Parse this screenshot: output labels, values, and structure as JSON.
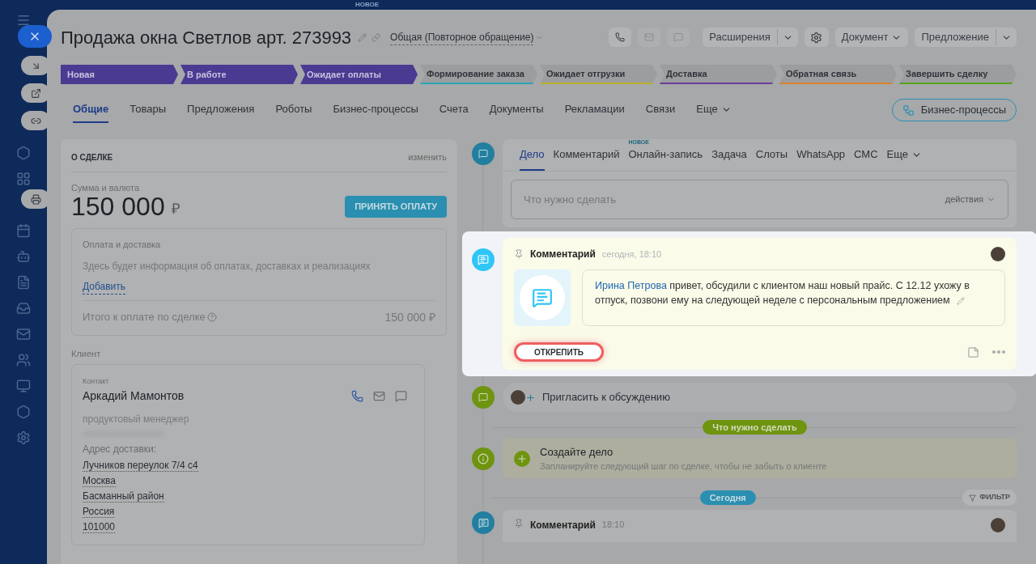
{
  "top_badge": "НОВОЕ",
  "title": "Продажа окна Светлов арт. 273993",
  "category": "Общая (Повторное обращение)",
  "header_buttons": [
    {
      "kind": "split",
      "label": "Расширения"
    },
    {
      "kind": "settings"
    },
    {
      "kind": "dropdown",
      "label": "Документ"
    },
    {
      "kind": "split",
      "label": "Предложение"
    }
  ],
  "stages": [
    {
      "label": "Новая",
      "passed": true,
      "color": "#4b3a92"
    },
    {
      "label": "В работе",
      "passed": true,
      "color": "#4b3a92"
    },
    {
      "label": "Ожидает оплаты",
      "passed": true,
      "color": "#4b3a92"
    },
    {
      "label": "Формирование заказа",
      "passed": false,
      "color": "#2aa5b5"
    },
    {
      "label": "Ожидает отгрузки",
      "passed": false,
      "color": "#b8b12a"
    },
    {
      "label": "Доставка",
      "passed": false,
      "color": "#6a3d9a"
    },
    {
      "label": "Обратная связь",
      "passed": false,
      "color": "#d9822b"
    },
    {
      "label": "Завершить сделку",
      "passed": false,
      "color": "#55a51c"
    }
  ],
  "tabs": [
    {
      "label": "Общие",
      "selected": true
    },
    {
      "label": "Товары",
      "selected": false
    },
    {
      "label": "Предложения",
      "selected": false
    },
    {
      "label": "Роботы",
      "selected": false
    },
    {
      "label": "Бизнес-процессы",
      "selected": false
    },
    {
      "label": "Счета",
      "selected": false
    },
    {
      "label": "Документы",
      "selected": false
    },
    {
      "label": "Рекламации",
      "selected": false
    },
    {
      "label": "Связи",
      "selected": false
    },
    {
      "label": "Еще",
      "selected": false
    }
  ],
  "bp_button": "Бизнес-процессы",
  "deal": {
    "heading": "О СДЕЛКЕ",
    "edit": "изменить",
    "amount_label": "Сумма и валюта",
    "amount": "150 000",
    "currency": "₽",
    "pay_button": "ПРИНЯТЬ ОПЛАТУ",
    "payment": {
      "title": "Оплата и доставка",
      "info": "Здесь будет информация об оплатах, доставках и реализациях",
      "add": "Добавить",
      "total_label": "Итого к оплате по сделке",
      "total": "150 000 ₽"
    },
    "client_label": "Клиент",
    "contact": {
      "label": "Контакт",
      "name": "Аркадий Мамонтов",
      "position": "продуктовый менеджер",
      "address_label": "Адрес доставки:",
      "address": [
        "Лучников переулок 7/4 с4",
        "Москва",
        "Басманный район",
        "Россия",
        "101000"
      ]
    }
  },
  "activity_tabs": [
    {
      "label": "Дело",
      "selected": true
    },
    {
      "label": "Комментарий",
      "selected": false
    },
    {
      "label": "Онлайн-запись",
      "selected": false,
      "badge": "НОВОЕ"
    },
    {
      "label": "Задача",
      "selected": false
    },
    {
      "label": "Слоты",
      "selected": false
    },
    {
      "label": "WhatsApp",
      "selected": false
    },
    {
      "label": "СМС",
      "selected": false
    },
    {
      "label": "Еще",
      "selected": false
    }
  ],
  "todo_placeholder": "Что нужно сделать",
  "actions": "действия",
  "pinned": {
    "title": "Комментарий",
    "time": "сегодня, 18:10",
    "mention": "Ирина Петрова",
    "text": "привет, обсудили с клиентом наш новый прайс. С 12.12 ухожу в отпуск, позвони ему на следующей неделе с персональным предложением",
    "unpin": "ОТКРЕПИТЬ"
  },
  "invite": "Пригласить к обсуждению",
  "todo_divider": "Что нужно сделать",
  "create": {
    "title": "Создайте дело",
    "subtitle": "Запланируйте следующий шаг по сделке, чтобы не забыть о клиенте"
  },
  "today": "Сегодня",
  "filter": "ФИЛЬТР",
  "last_comment": {
    "title": "Комментарий",
    "time": "18:10"
  }
}
